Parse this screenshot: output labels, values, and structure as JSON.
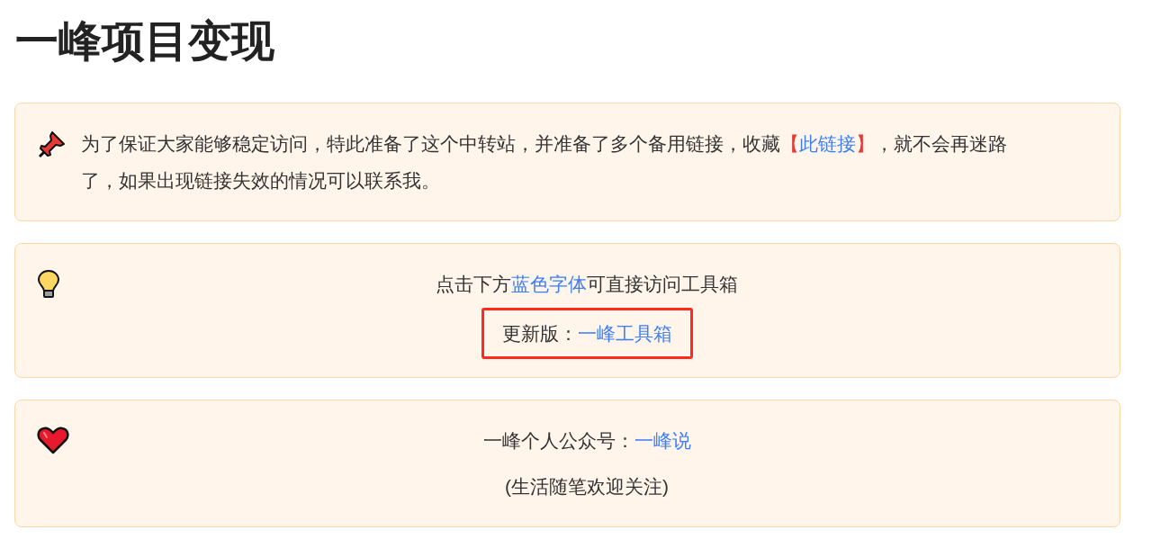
{
  "title": "一峰项目变现",
  "cards": [
    {
      "icon": {
        "kind": "pushpin"
      },
      "kind": "plain",
      "lines": [
        {
          "highlighted": false,
          "parts": [
            {
              "kind": "text",
              "text": "为了保证大家能够稳定访问，特此准备了这个中转站，并准备了多个备用链接，收藏"
            },
            {
              "kind": "bracket",
              "text": "【"
            },
            {
              "kind": "link",
              "text": "此链接"
            },
            {
              "kind": "bracket",
              "text": "】"
            },
            {
              "kind": "text",
              "text": "，就不会再迷路了，如果出现链接失效的情况可以联系我。"
            }
          ]
        }
      ]
    },
    {
      "icon": {
        "kind": "bulb"
      },
      "kind": "centered",
      "lines": [
        {
          "highlighted": false,
          "parts": [
            {
              "kind": "text",
              "text": "点击下方"
            },
            {
              "kind": "link",
              "text": "蓝色字体"
            },
            {
              "kind": "text",
              "text": "可直接访问工具箱"
            }
          ]
        },
        {
          "highlighted": true,
          "parts": [
            {
              "kind": "text",
              "text": "更新版："
            },
            {
              "kind": "link",
              "text": "一峰工具箱"
            }
          ]
        }
      ]
    },
    {
      "icon": {
        "kind": "heart"
      },
      "kind": "centered",
      "lines": [
        {
          "highlighted": false,
          "parts": [
            {
              "kind": "text",
              "text": "一峰个人公众号："
            },
            {
              "kind": "link",
              "text": "一峰说"
            }
          ]
        },
        {
          "highlighted": false,
          "parts": [
            {
              "kind": "text",
              "text": "(生活随笔欢迎关注)"
            }
          ]
        }
      ]
    }
  ]
}
